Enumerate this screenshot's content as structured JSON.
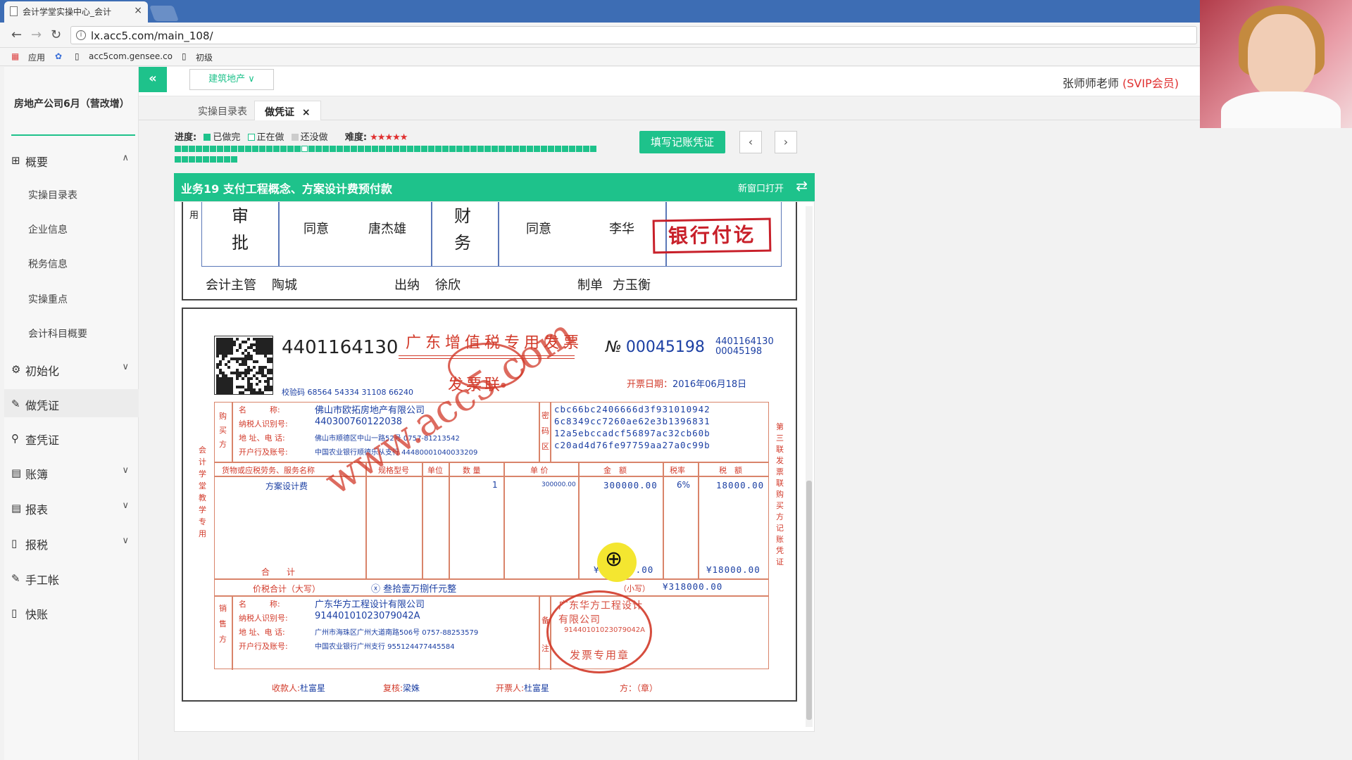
{
  "browser": {
    "tab_title": "会计学堂实操中心_会计",
    "url": "lx.acc5.com/main_108/",
    "bookmarks": [
      "应用",
      "acc5com.gensee.co",
      "初级"
    ]
  },
  "sidebar": {
    "company": "房地产公司6月（营改增）",
    "menu": [
      {
        "label": "概要"
      },
      {
        "label": "初始化"
      },
      {
        "label": "做凭证"
      },
      {
        "label": "查凭证"
      },
      {
        "label": "账簿"
      },
      {
        "label": "报表"
      },
      {
        "label": "报税"
      },
      {
        "label": "手工帐"
      },
      {
        "label": "快账"
      }
    ],
    "submenu": [
      "实操目录表",
      "企业信息",
      "税务信息",
      "实操重点",
      "会计科目概要"
    ]
  },
  "topbar": {
    "collapse": "«",
    "industry": "建筑地产 ∨",
    "user_name": "张师师老师",
    "user_level": "(SVIP会员)"
  },
  "tabs": [
    "实操目录表",
    "做凭证"
  ],
  "progress": {
    "label": "进度:",
    "done": "已做完",
    "doing": "正在做",
    "todo": "还没做",
    "difficulty": "难度:",
    "stars": "★★★★★",
    "done_count": 69,
    "current_index": 18
  },
  "actions": {
    "fill": "填写记账凭证",
    "prev": "‹",
    "next": "›"
  },
  "business": {
    "title": "业务19 支付工程概念、方案设计费预付款",
    "new_window": "新窗口打开",
    "swap": "⇄"
  },
  "approval": {
    "col1": "用",
    "shen": "审",
    "pi": "批",
    "agree1": "同意",
    "name1": "唐杰雄",
    "cai": "财",
    "wu": "务",
    "agree2": "同意",
    "name2": "李华",
    "stamp": "银行付讫",
    "footer_supervisor_label": "会计主管",
    "footer_supervisor": "陶城",
    "footer_cashier_label": "出纳",
    "footer_cashier": "徐欣",
    "footer_maker_label": "制单",
    "footer_maker": "方玉衡"
  },
  "invoice": {
    "code": "4401164130",
    "title": "广东增值税专用发票",
    "subtitle": "发票联",
    "no_label": "№",
    "number": "00045198",
    "code_small": "4401164130",
    "number_small": "00045198",
    "check_code": "校验码 68564 54334 31108 66240",
    "date_label": "开票日期：",
    "date": "2016年06月18日",
    "side_left": "会计学堂教学专用",
    "side_right": "第三联 发票联 购买方记账凭证",
    "buyer_section": "购买方",
    "buyer_labels": [
      "名　　　称:",
      "纳税人识别号:",
      "地 址、电 话:",
      "开户行及账号:"
    ],
    "buyer_name": "佛山市欧拓房地产有限公司",
    "buyer_tax_id": "440300760122038",
    "buyer_addr": "佛山市顺德区中山一路52号 0757-81213542",
    "buyer_bank": "中国农业银行顺德乐从支行 44480001040033209",
    "cipher_label": "密码区",
    "cipher": [
      "cbc66bc2406666d3f931010942",
      "6c8349cc7260ae62e3b1396831",
      "12a5ebccadcf56897ac32cb60b",
      "c20ad4d76fe97759aa27a0c99b"
    ],
    "item_headers": [
      "货物或应税劳务、服务名称",
      "规格型号",
      "单位",
      "数 量",
      "单 价",
      "金　额",
      "税率",
      "税　额"
    ],
    "item_name": "方案设计费",
    "item_qty": "1",
    "item_price": "300000.00",
    "item_amount": "300000.00",
    "item_rate": "6%",
    "item_tax": "18000.00",
    "total_label": "合　　计",
    "total_amount": "¥300000.00",
    "total_tax": "¥18000.00",
    "sum_label": "价税合计（大写）",
    "sum_words": "ⓧ 叁拾壹万捌仟元整",
    "sum_small_label": "（小写）",
    "sum_small": "¥318000.00",
    "seller_section": "销售方",
    "seller_labels": [
      "名　　　称:",
      "纳税人识别号:",
      "地 址、电 话:",
      "开户行及账号:"
    ],
    "seller_name": "广东华方工程设计有限公司",
    "seller_tax_id": "91440101023079042A",
    "seller_addr": "广州市海珠区广州大道南路506号 0757-88253579",
    "seller_bank": "中国农业银行广州支行 955124477445584",
    "remark_label": "备注",
    "seal_name": "广东华方工程设计有限公司",
    "seal_id": "91440101023079042A",
    "seal_type": "发票专用章",
    "watermark": "www.acc5.com",
    "payee_label": "收款人:",
    "payee": "杜富星",
    "reviewer_label": "复核:",
    "reviewer": "梁姝",
    "issuer_label": "开票人:",
    "issuer": "杜富星",
    "seller_stamp_label": "方：（章）"
  },
  "colors": {
    "accent": "#1ec28b",
    "invoice_red": "#d23a2a",
    "invoice_blue": "#1b3fa3"
  }
}
